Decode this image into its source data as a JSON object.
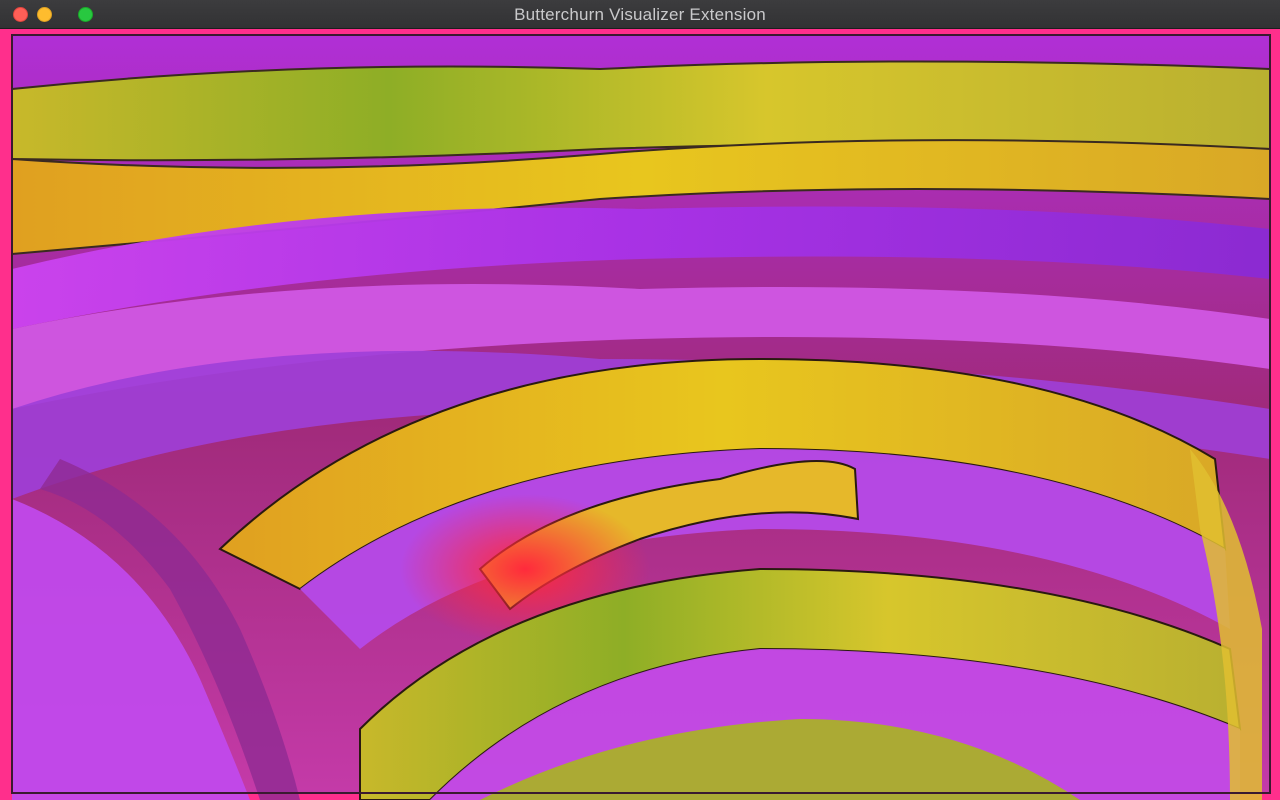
{
  "window": {
    "title": "Butterchurn Visualizer Extension"
  },
  "controls": {
    "close": "close-button",
    "minimize": "minimize-button",
    "maximize": "maximize-button"
  },
  "colors": {
    "border": "#ff2f8c",
    "magenta": "#cf3cf2",
    "violet": "#9c2ee0",
    "olive": "#b8b62a",
    "yellow": "#f0d21c",
    "orange": "#f0941c",
    "red": "#ff2a3c"
  }
}
